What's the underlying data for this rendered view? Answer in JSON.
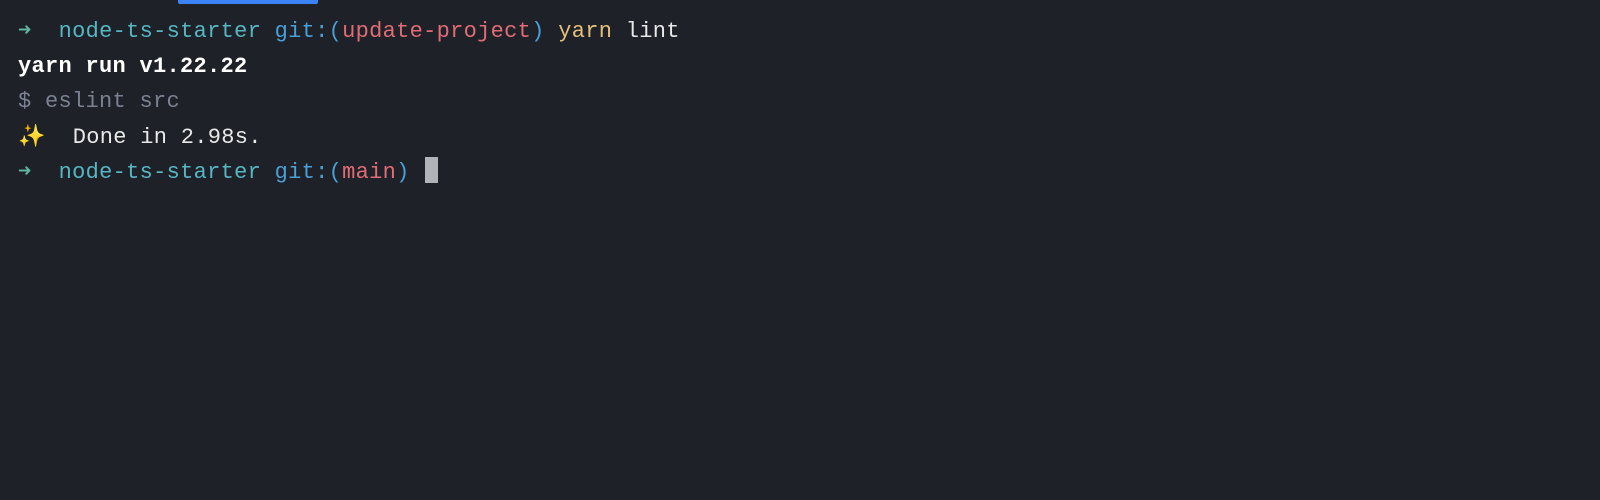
{
  "prompt1": {
    "arrow": "➜",
    "dir": "node-ts-starter",
    "git_label": "git:(",
    "branch": "update-project",
    "git_close": ")",
    "cmd_part1": "yarn",
    "cmd_part2": "lint"
  },
  "output": {
    "yarn_run": "yarn run v1.22.22",
    "shell_prefix": "$",
    "shell_cmd": "eslint src",
    "sparkle": "✨",
    "done_msg": "Done in 2.98s."
  },
  "prompt2": {
    "arrow": "➜",
    "dir": "node-ts-starter",
    "git_label": "git:(",
    "branch": "main",
    "git_close": ")"
  }
}
